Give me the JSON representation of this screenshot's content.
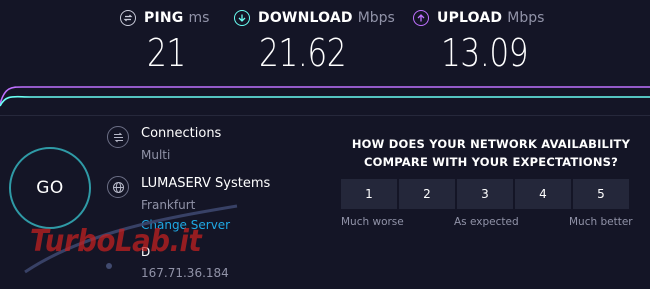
{
  "metrics": {
    "ping": {
      "label": "PING",
      "unit": "ms",
      "value": "21",
      "icon": "ping-icon"
    },
    "download": {
      "label": "DOWNLOAD",
      "unit": "Mbps",
      "value": "21.62",
      "icon": "download-arrow-icon"
    },
    "upload": {
      "label": "UPLOAD",
      "unit": "Mbps",
      "value": "13.09",
      "icon": "upload-arrow-icon"
    }
  },
  "colors": {
    "background": "#141526",
    "download_accent": "#6afff3",
    "upload_accent": "#bf71ff",
    "go_ring": "#2f9aa6",
    "link": "#1fa9e5",
    "muted_text": "#9193a8"
  },
  "go_button": {
    "label": "GO"
  },
  "connections": {
    "title": "Connections",
    "value": "Multi"
  },
  "server": {
    "name": "LUMASERV Systems",
    "location": "Frankfurt",
    "change_link": "Change Server"
  },
  "host": {
    "name": "D",
    "ip": "167.71.36.184"
  },
  "watermark": {
    "text": "TurboLab.it"
  },
  "survey": {
    "question_line1": "HOW DOES YOUR NETWORK AVAILABILITY",
    "question_line2": "COMPARE WITH YOUR EXPECTATIONS?",
    "options": [
      "1",
      "2",
      "3",
      "4",
      "5"
    ],
    "label_low": "Much worse",
    "label_mid": "As expected",
    "label_high": "Much better"
  }
}
